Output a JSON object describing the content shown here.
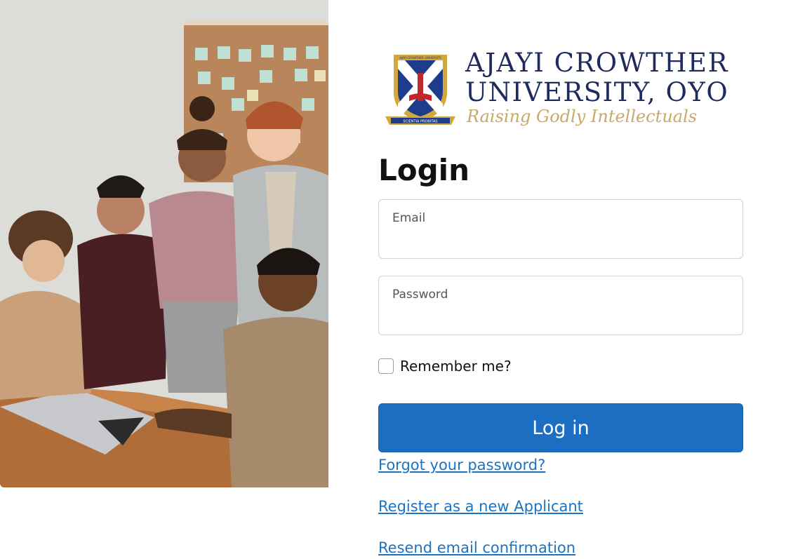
{
  "hero_image": {
    "description_icon": "people-with-laptop-photo"
  },
  "logo": {
    "crest_icon": "university-crest-icon",
    "crest_text": "AJAYI CROWTHER UNIVERSITY",
    "crest_motto": "SCIENTIA PROBITAS",
    "line1": "AJAYI CROWTHER",
    "line2": "UNIVERSITY, OYO",
    "tagline": "Raising Godly Intellectuals",
    "colors": {
      "navy": "#1f2b5c",
      "gold": "#c9a86a",
      "red": "#c0282d"
    }
  },
  "form": {
    "title": "Login",
    "email": {
      "label": "Email",
      "value": ""
    },
    "password": {
      "label": "Password",
      "value": ""
    },
    "remember_me": {
      "label": "Remember me?",
      "checked": false
    },
    "submit_label": "Log in",
    "submit_color": "#1b6ec2"
  },
  "links": {
    "forgot_password": "Forgot your password?",
    "register": "Register as a new Applicant",
    "resend_confirmation": "Resend email confirmation",
    "color": "#1a73c4"
  }
}
